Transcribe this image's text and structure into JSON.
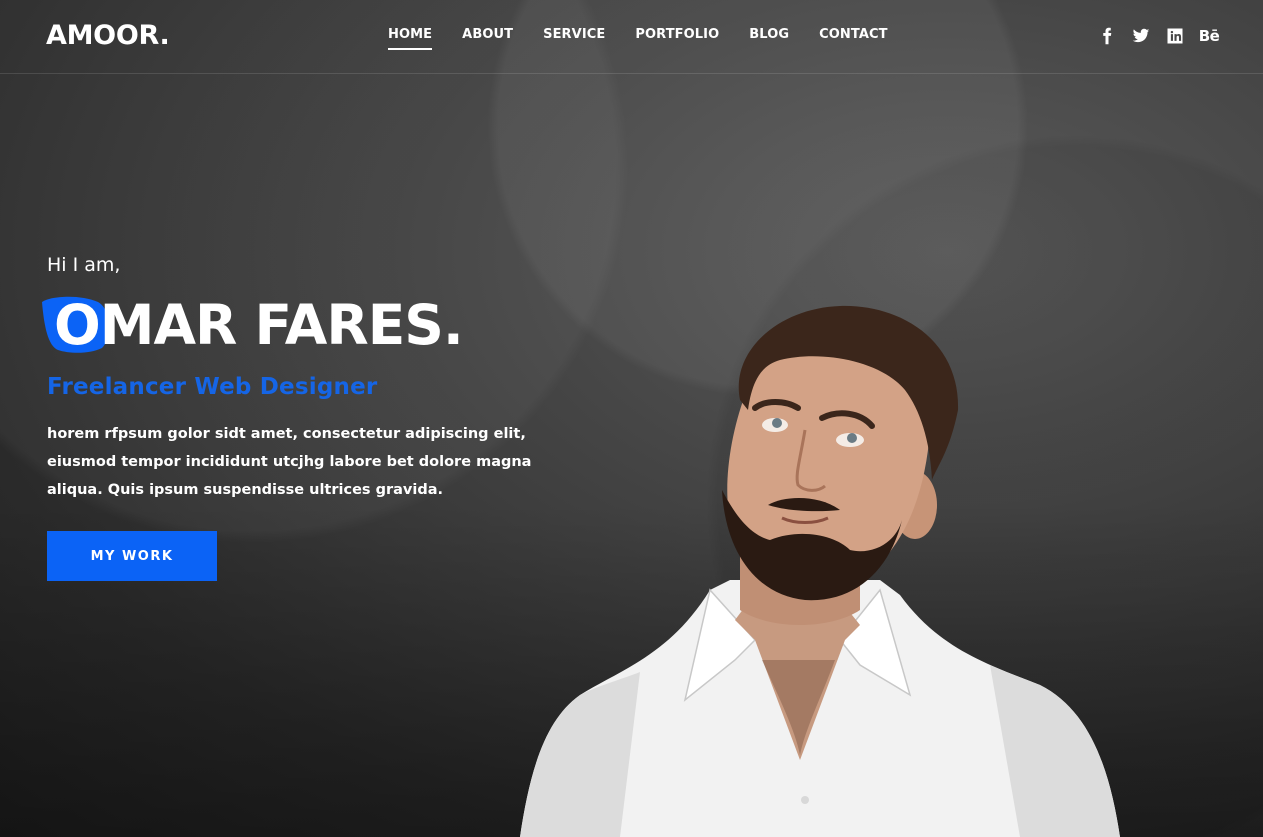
{
  "header": {
    "logo": "AMOOR.",
    "nav": [
      "HOME",
      "ABOUT",
      "SERVICE",
      "PORTFOLIO",
      "BLOG",
      "CONTACT"
    ],
    "active_nav": "HOME",
    "social": [
      {
        "icon": "facebook-icon"
      },
      {
        "icon": "twitter-icon"
      },
      {
        "icon": "linkedin-icon"
      },
      {
        "icon": "behance-icon",
        "label": "Bē"
      }
    ]
  },
  "hero": {
    "greeting": "Hi I am,",
    "name": "OMAR FARES.",
    "role": "Freelancer Web Designer",
    "description": "horem rfpsum golor sidt amet, consectetur adipiscing elit, eiusmod tempor incididunt utcjhg labore bet dolore magna aliqua. Quis ipsum suspendisse ultrices gravida.",
    "cta_label": "MY WORK"
  },
  "colors": {
    "accent": "#0b63f6",
    "role_text": "#1565e6",
    "background": "#3a3a3a"
  }
}
